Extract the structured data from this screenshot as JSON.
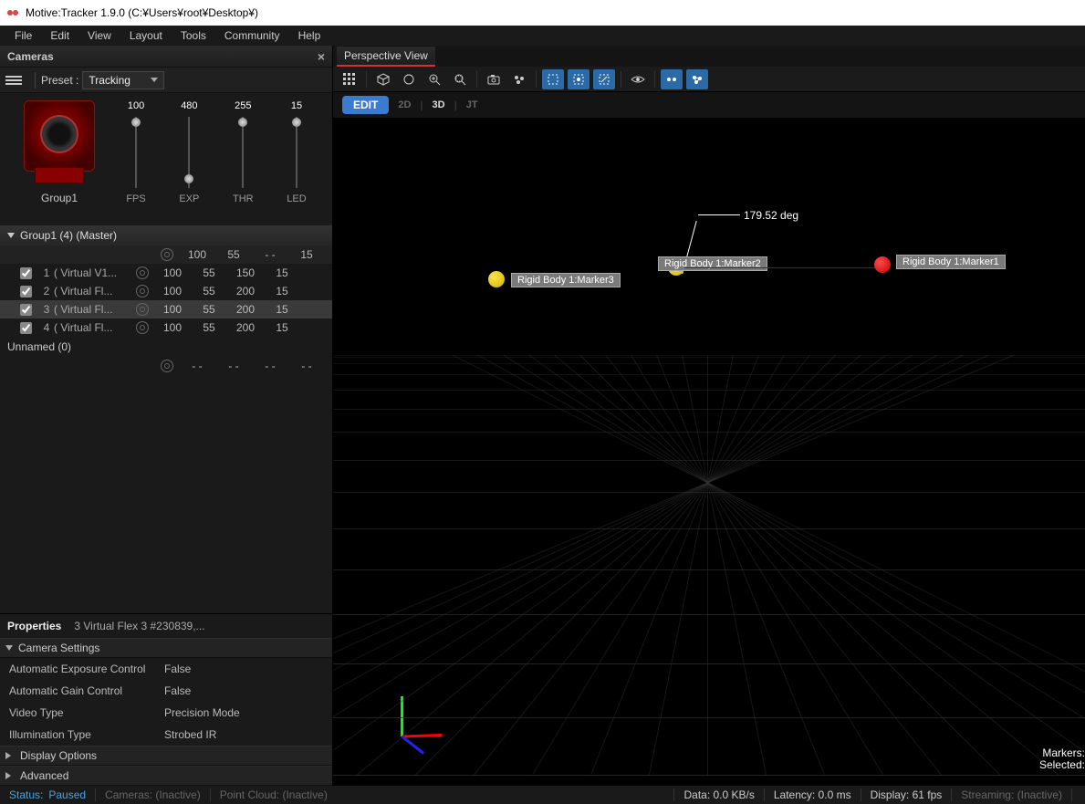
{
  "window": {
    "title": "Motive:Tracker 1.9.0 (C:¥Users¥root¥Desktop¥)"
  },
  "menu": [
    "File",
    "Edit",
    "View",
    "Layout",
    "Tools",
    "Community",
    "Help"
  ],
  "cameras": {
    "title": "Cameras",
    "preset_label": "Preset :",
    "preset_value": "Tracking",
    "group_name": "Group1",
    "sliders": [
      {
        "label": "FPS",
        "value": "100",
        "knob": 0.02
      },
      {
        "label": "EXP",
        "value": "480",
        "knob": 0.92
      },
      {
        "label": "THR",
        "value": "255",
        "knob": 0.02
      },
      {
        "label": "LED",
        "value": "15",
        "knob": 0.02
      }
    ],
    "tree_header": "Group1 (4) (Master)",
    "cols": [
      "100",
      "55",
      "- -",
      "15"
    ],
    "items": [
      {
        "idx": "1",
        "name": "( Virtual V1...",
        "vals": [
          "100",
          "55",
          "150",
          "15"
        ]
      },
      {
        "idx": "2",
        "name": "( Virtual Fl...",
        "vals": [
          "100",
          "55",
          "200",
          "15"
        ]
      },
      {
        "idx": "3",
        "name": "( Virtual Fl...",
        "vals": [
          "100",
          "55",
          "200",
          "15"
        ]
      },
      {
        "idx": "4",
        "name": "( Virtual Fl...",
        "vals": [
          "100",
          "55",
          "200",
          "15"
        ]
      }
    ],
    "unnamed": "Unnamed (0)",
    "unnamed_vals": [
      "- -",
      "- -",
      "- -",
      "- -"
    ]
  },
  "properties": {
    "title": "Properties",
    "subtitle": "3 Virtual Flex 3 #230839,...",
    "sect_camera": "Camera Settings",
    "rows": [
      {
        "k": "Automatic Exposure Control",
        "v": "False"
      },
      {
        "k": "Automatic Gain Control",
        "v": "False"
      },
      {
        "k": "Video Type",
        "v": "Precision Mode"
      },
      {
        "k": "Illumination Type",
        "v": "Strobed IR"
      }
    ],
    "sect_display": "Display Options",
    "sect_advanced": "Advanced"
  },
  "view": {
    "tab": "Perspective View",
    "modes": {
      "edit": "EDIT",
      "d2": "2D",
      "d3": "3D",
      "jt": "JT"
    },
    "angle": "179.52 deg",
    "tags": {
      "m1": "Rigid Body 1:Marker1",
      "m2": "Rigid Body 1:Marker2",
      "m3": "Rigid Body 1:Marker3"
    },
    "hud": {
      "line1": "Markers:",
      "line2": "Selected:"
    }
  },
  "status": {
    "status_label": "Status:",
    "status_val": "Paused",
    "cameras": "Cameras: (Inactive)",
    "pointcloud": "Point Cloud: (Inactive)",
    "data": "Data: 0.0 KB/s",
    "latency": "Latency: 0.0 ms",
    "display": "Display: 61 fps",
    "streaming": "Streaming: (Inactive)"
  }
}
